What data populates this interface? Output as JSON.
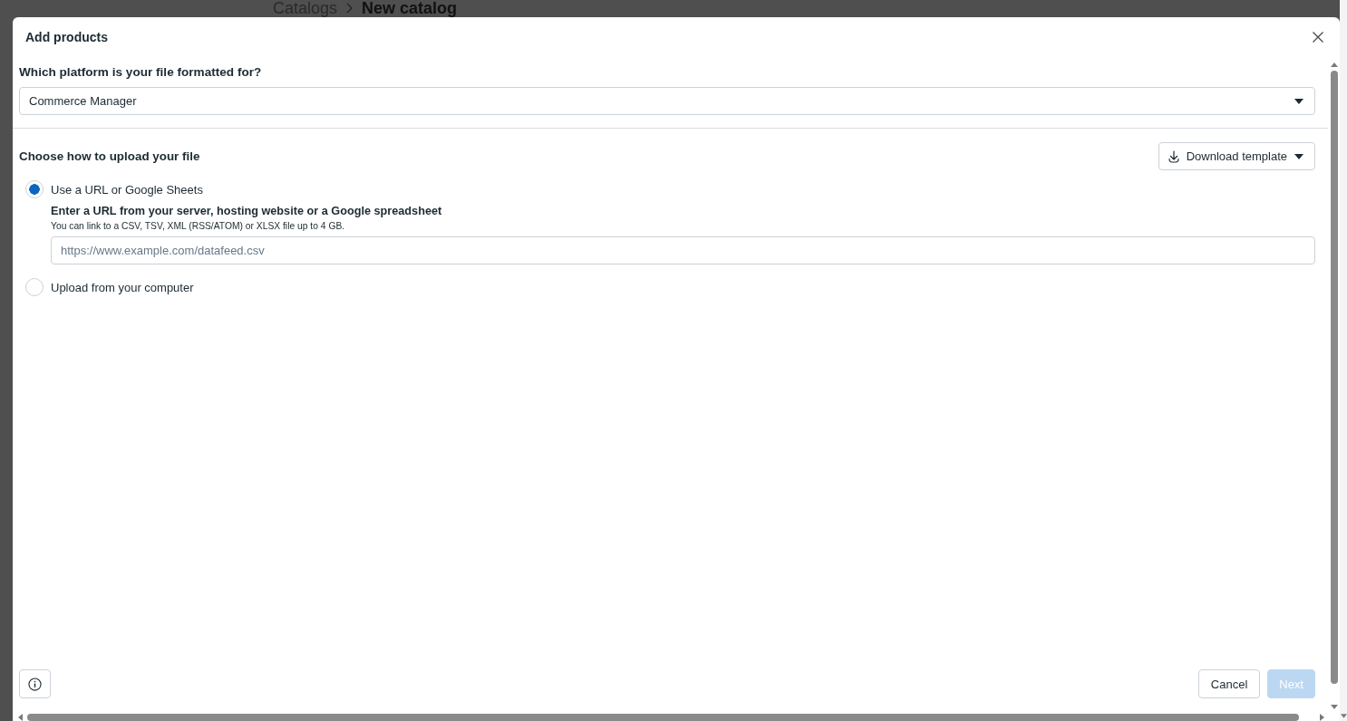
{
  "breadcrumb": [
    {
      "label": "Catalogs",
      "current": false
    },
    {
      "label": "New catalog",
      "current": true
    }
  ],
  "dialog": {
    "title": "Add products",
    "platform": {
      "question": "Which platform is your file formatted for?",
      "value": "Commerce Manager"
    },
    "upload": {
      "heading": "Choose how to upload your file",
      "download_button": "Download template",
      "options": [
        {
          "label": "Use a URL or Google Sheets",
          "selected": true,
          "url_field": {
            "heading": "Enter a URL from your server, hosting website or a Google spreadsheet",
            "hint": "You can link to a CSV, TSV, XML (RSS/ATOM) or XLSX file up to 4 GB.",
            "placeholder": "https://www.example.com/datafeed.csv"
          }
        },
        {
          "label": "Upload from your computer",
          "selected": false
        }
      ]
    },
    "footer": {
      "buttons": [
        {
          "label": "Cancel",
          "kind": "secondary",
          "disabled": false
        },
        {
          "label": "Next",
          "kind": "primary",
          "disabled": true
        }
      ]
    }
  }
}
